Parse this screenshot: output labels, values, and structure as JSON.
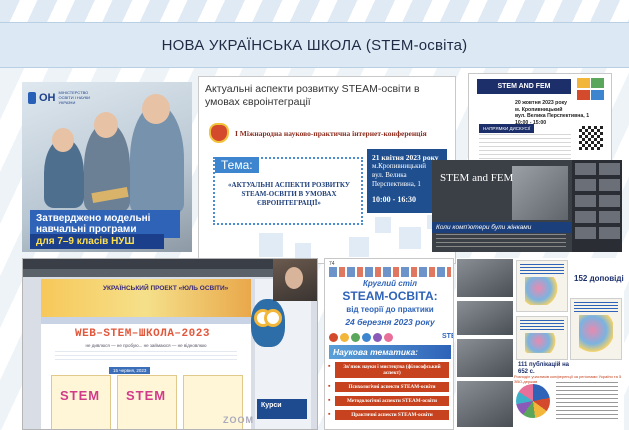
{
  "header": {
    "title": "НОВА УКРАЇНСЬКА ШКОЛА (STEM-освіта)"
  },
  "ministry_poster": {
    "logo_mark": "ОН",
    "logo_text": "МІНІСТЕРСТВО ОСВІТИ І НАУКИ УКРАЇНИ",
    "line1": "Затверджено модельні навчальні програми",
    "line2": "для 7–9 класів НУШ"
  },
  "conference": {
    "title": "Актуальні аспекти розвитку STEAM-освіти в умовах євроінтеграції",
    "conference_name": "І Міжнародна науково-практична інтернет-конференція",
    "tema_label": "Тема:",
    "topic": "«АКТУАЛЬНІ АСПЕКТИ РОЗВИТКУ STEAM-ОСВІТИ В УМОВАХ ЄВРОІНТЕГРАЦІЇ»",
    "date": "21 квітня 2023 року",
    "city": "м.Кропивницький",
    "address": "вул. Велика Перспективна, 1",
    "time": "10:00 - 16:30"
  },
  "stem_fem_poster": {
    "header": "STEM AND FEM",
    "date": "20 жовтня 2023 року",
    "city": "м. Кропивницький",
    "address": "вул. Велика Перспективна, 1",
    "time": "10:00 - 15:00",
    "button": "НАПРЯМКИ ДИСКУСІЇ"
  },
  "stem_fem_video": {
    "title": "STEM and FEM",
    "caption": "Коли комп'ютери були жінками"
  },
  "web_stem": {
    "project": "УКРАЇНСЬКИЙ ПРОЕКТ «ЮЛЬ ОСВІТИ»",
    "headline": "WEB–STEM–ШКОЛА–2023",
    "motto": "не дивлюся — не пробую... не займаюся — не відновлюю",
    "date_chip": "15 червня, 2023",
    "card_logo": "STEM",
    "courses": "Курси",
    "zoom": "ZOOM"
  },
  "round_table": {
    "page_number": "74",
    "kind": "Круглий стіл",
    "title": "STEAM-ОСВІТА:",
    "subtitle": "від теорії до практики",
    "date": "24 березня 2023 року",
    "steam_tag": "STEAM",
    "theme_header": "Наукова тематика:",
    "topics": [
      "Зв'язок науки і мистецтва (філософський аспект)",
      "Психологічні аспекти STEAM-освіти",
      "Методологічні аспекти STEAM-освіти",
      "Практичні аспекти STEAM-освіти"
    ]
  },
  "publications": {
    "reports": "152 доповіді",
    "publications": "111 публікацій на 652 с.",
    "legend_title": "Розподіл учасників конференції за регіонами України та 5 ЗВО-держав"
  },
  "colors": {
    "title_bar": "#dce9f5",
    "accent_blue": "#2f63b8",
    "accent_red": "#c7431f"
  }
}
